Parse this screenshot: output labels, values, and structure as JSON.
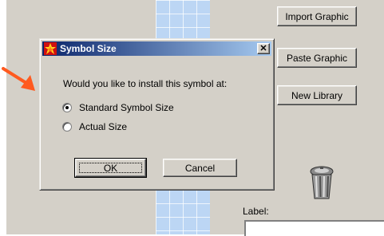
{
  "background": {
    "import_graphic_label": "Import Graphic",
    "paste_graphic_label": "Paste Graphic",
    "new_library_label": "New Library",
    "label_caption": "Label:",
    "trash_icon": "trash-can-icon"
  },
  "dialog": {
    "title": "Symbol Size",
    "close_glyph": "✕",
    "prompt": "Would you like to install this symbol at:",
    "options": [
      {
        "label": "Standard Symbol Size",
        "checked": true
      },
      {
        "label": "Actual Size",
        "checked": false
      }
    ],
    "ok_label": "OK",
    "cancel_label": "Cancel"
  },
  "annotation": {
    "arrow_color": "#ff5a1f"
  },
  "colors": {
    "title_start": "#0a246a",
    "title_end": "#a6caf0",
    "panel": "#d4d0c8",
    "grid": "#bcd6f4"
  }
}
